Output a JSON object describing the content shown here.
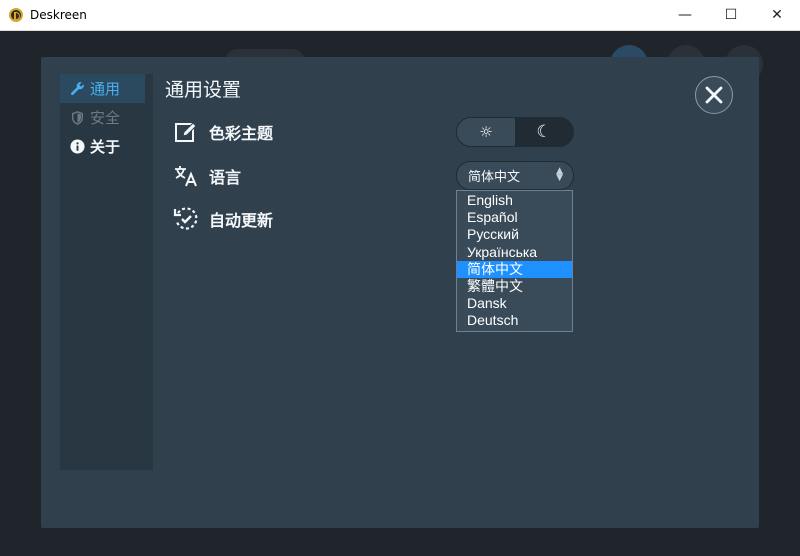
{
  "window": {
    "title": "Deskreen",
    "minimize_glyph": "—",
    "maximize_glyph": "☐",
    "close_glyph": "✕"
  },
  "dialog": {
    "title": "通用设置"
  },
  "sidebar": {
    "items": [
      {
        "label": "通用",
        "icon": "wrench-icon",
        "state": "active"
      },
      {
        "label": "安全",
        "icon": "shield-icon",
        "state": "disabled"
      },
      {
        "label": "关于",
        "icon": "info-icon",
        "state": "normal"
      }
    ]
  },
  "settings": {
    "theme_label": "色彩主题",
    "language_label": "语言",
    "autoupdate_label": "自动更新",
    "theme": {
      "light_glyph": "☼",
      "dark_glyph": "☾",
      "selected": "dark"
    },
    "language": {
      "selected": "简体中文",
      "options": [
        "English",
        "Español",
        "Русский",
        "Українська",
        "简体中文",
        "繁體中文",
        "Dansk",
        "Deutsch"
      ]
    }
  },
  "colors": {
    "accent": "#48aff0",
    "dialog_bg": "#30404d",
    "selected_option": "#1e90ff"
  }
}
